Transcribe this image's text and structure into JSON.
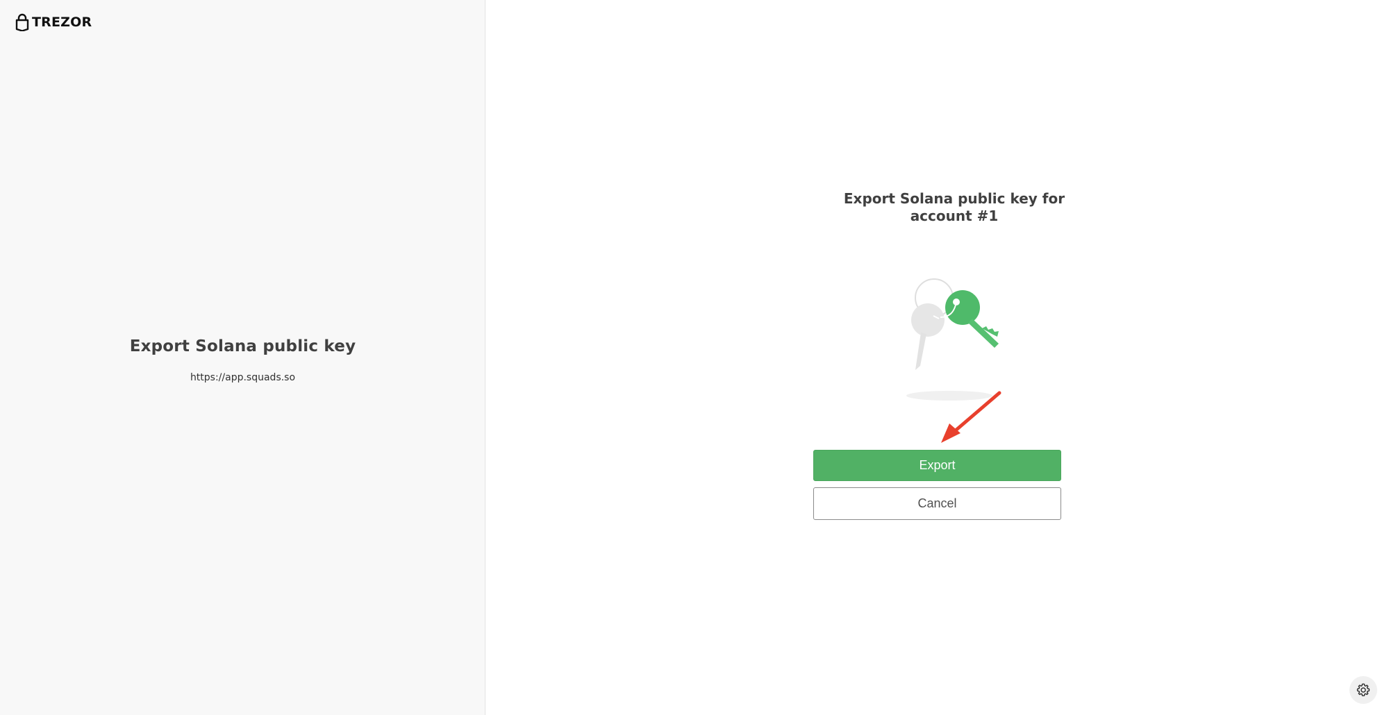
{
  "brand": {
    "name": "TREZOR",
    "icon": "trezor-lock-icon"
  },
  "left_panel": {
    "title": "Export Solana public key",
    "origin": "https://app.squads.so"
  },
  "main": {
    "title": "Export Solana public key for account #1",
    "illustration": "keys-illustration",
    "export_label": "Export",
    "cancel_label": "Cancel"
  },
  "settings": {
    "icon": "gear-icon"
  },
  "colors": {
    "accent": "#51b165",
    "annotation_arrow": "#e8402d",
    "left_bg": "#f8f8f8"
  }
}
